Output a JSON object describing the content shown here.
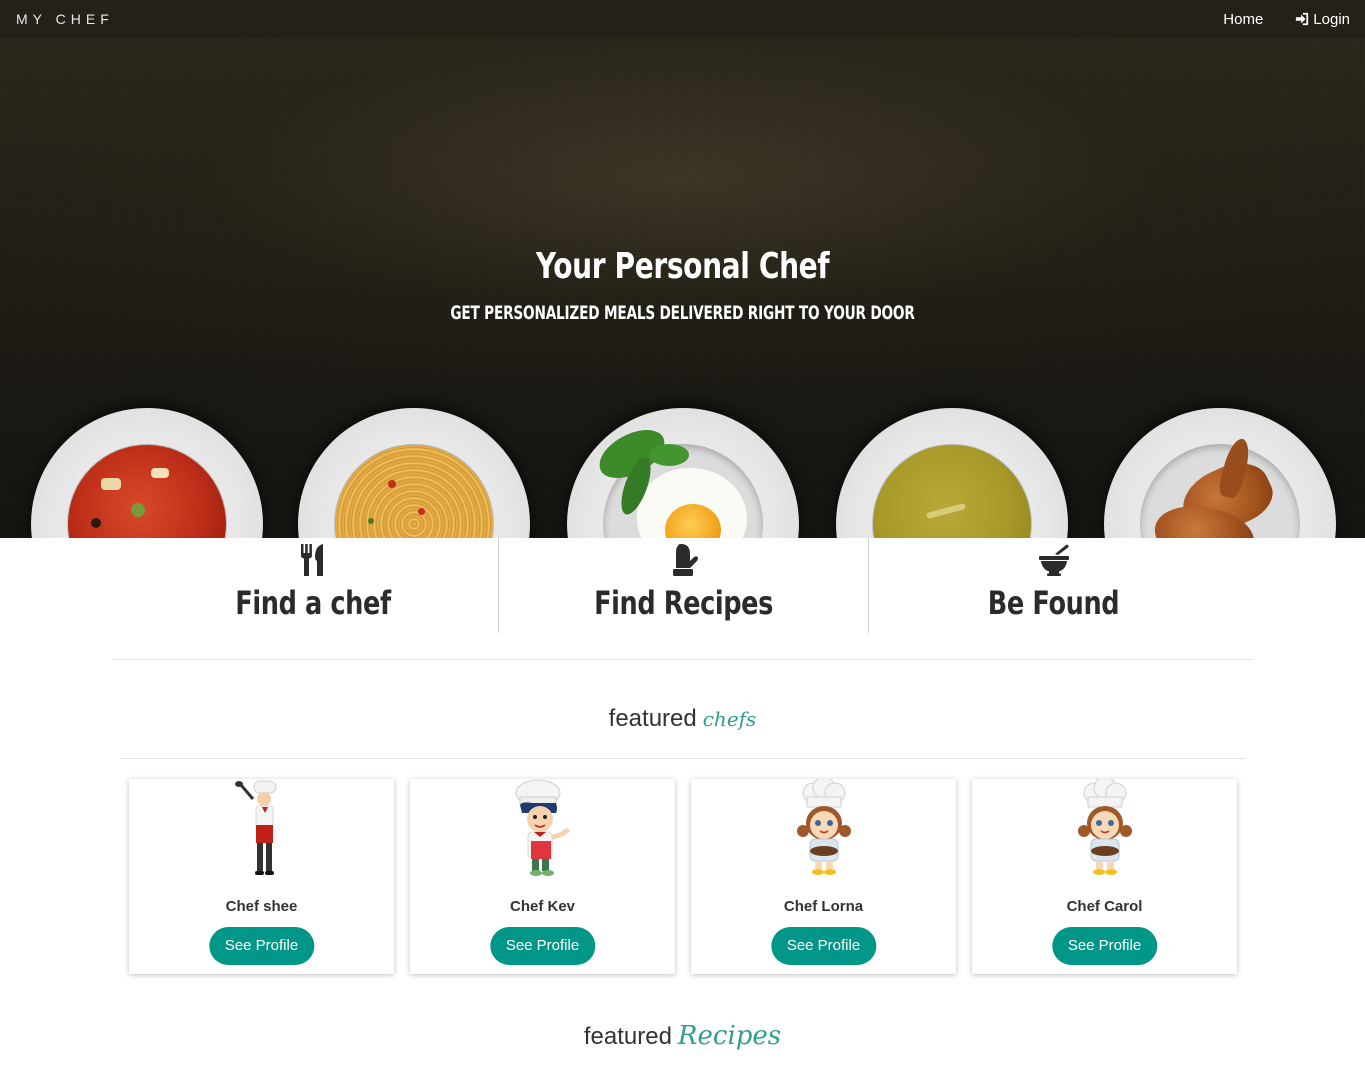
{
  "nav": {
    "brand": "MY CHEF",
    "home": "Home",
    "login": "Login",
    "login_icon": "sign-in-icon"
  },
  "hero": {
    "title": "Your Personal Chef",
    "subtitle": "GET PERSONALIZED MEALS DELIVERED RIGHT TO YOUR DOOR",
    "plates": [
      "tomato-soup",
      "spaghetti",
      "fried-egg",
      "pea-soup",
      "croissants"
    ]
  },
  "features": [
    {
      "title": "Find a chef",
      "icon": "cutlery-icon"
    },
    {
      "title": "Find Recipes",
      "icon": "oven-mitt-icon"
    },
    {
      "title": "Be Found",
      "icon": "mortar-pestle-icon"
    }
  ],
  "featured_chefs": {
    "label": "featured",
    "accent": "chefs",
    "chefs": [
      {
        "name": "Chef shee",
        "button": "See Profile"
      },
      {
        "name": "Chef Kev",
        "button": "See Profile"
      },
      {
        "name": "Chef Lorna",
        "button": "See Profile"
      },
      {
        "name": "Chef Carol",
        "button": "See Profile"
      }
    ]
  },
  "featured_recipes": {
    "label": "featured",
    "accent": "Recipes"
  },
  "colors": {
    "navbar": "#242218",
    "accent": "#2f9e8e",
    "button": "#009688"
  }
}
